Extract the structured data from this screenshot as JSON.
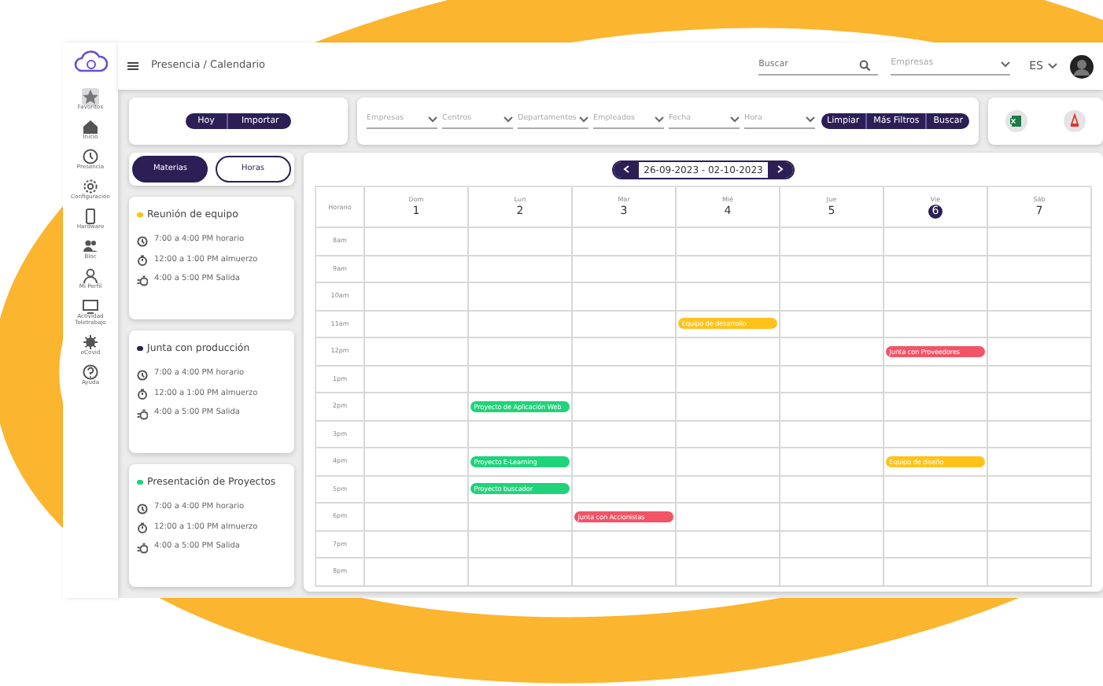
{
  "breadcrumb": "Presencia / Calendario",
  "search": {
    "placeholder": "Buscar"
  },
  "company_select": {
    "placeholder": "Empresas"
  },
  "language": "ES",
  "sidebar": {
    "items": [
      {
        "label": "Favoritos",
        "selected": true
      },
      {
        "label": "Inicio",
        "selected": false
      },
      {
        "label": "Presencia",
        "selected": false
      },
      {
        "label": "Configuración",
        "selected": false
      },
      {
        "label": "Hardware",
        "selected": false
      },
      {
        "label": "Bloc",
        "selected": false
      },
      {
        "label": "Mi Perfil",
        "selected": false
      },
      {
        "label": "Actividad Teletrabajo",
        "selected": false
      },
      {
        "label": "eCovid",
        "selected": false
      },
      {
        "label": "Ayuda",
        "selected": false
      }
    ]
  },
  "actions": [
    "Hoy",
    "Importar"
  ],
  "filters": [
    {
      "placeholder": "Empresas"
    },
    {
      "placeholder": "Centros"
    },
    {
      "placeholder": "Departamentos"
    },
    {
      "placeholder": "Empleados"
    },
    {
      "placeholder": "Fecha"
    },
    {
      "placeholder": "Hora"
    }
  ],
  "filter_buttons": [
    "Limpiar",
    "Más Filtros",
    "Buscar"
  ],
  "view_tabs": [
    {
      "label": "Materias",
      "selected": true
    },
    {
      "label": "Horas",
      "selected": false
    }
  ],
  "schedule_cards": [
    {
      "title": "Reunión de equipo",
      "color": "#ffc107",
      "lines": [
        "7:00 a 4:00 PM horario",
        "12:00 a 1:00 PM almuerzo",
        "4:00 a 5:00 PM Salida"
      ]
    },
    {
      "title": "Junta con producción",
      "color": "#2b1f55",
      "lines": [
        "7:00 a 4:00 PM horario",
        "12:00 a 1:00 PM almuerzo",
        "4:00 a 5:00 PM Salida"
      ]
    },
    {
      "title": "Presentación de Proyectos",
      "color": "#1ed37a",
      "lines": [
        "7:00 a 4:00 PM horario",
        "12:00 a 1:00 PM almuerzo",
        "4:00 a 5:00 PM Salida"
      ]
    }
  ],
  "calendar": {
    "date_range": "26-09-2023 - 02-10-2023",
    "corner_label": "Horario",
    "days": [
      {
        "name": "Dom",
        "number": "1",
        "selected": false
      },
      {
        "name": "Lun",
        "number": "2",
        "selected": false
      },
      {
        "name": "Mar",
        "number": "3",
        "selected": false
      },
      {
        "name": "Mié",
        "number": "4",
        "selected": false
      },
      {
        "name": "Jue",
        "number": "5",
        "selected": false
      },
      {
        "name": "Vie",
        "number": "6",
        "selected": true
      },
      {
        "name": "Sáb",
        "number": "7",
        "selected": false
      }
    ],
    "rows": [
      {
        "hour": "8am",
        "cells": [
          null,
          null,
          null,
          null,
          null,
          null,
          null
        ]
      },
      {
        "hour": "9am",
        "cells": [
          null,
          null,
          null,
          null,
          null,
          null,
          null
        ]
      },
      {
        "hour": "10am",
        "cells": [
          null,
          null,
          null,
          null,
          null,
          null,
          null
        ]
      },
      {
        "hour": "11am",
        "cells": [
          null,
          null,
          null,
          {
            "event": "Equipo de desarrollo",
            "color": "#ffc21a"
          },
          null,
          null,
          null
        ]
      },
      {
        "hour": "12pm",
        "cells": [
          null,
          null,
          null,
          null,
          null,
          {
            "event": "Junta con Proveedores",
            "color": "#f25366"
          },
          null
        ]
      },
      {
        "hour": "1pm",
        "cells": [
          null,
          null,
          null,
          null,
          null,
          null,
          null
        ]
      },
      {
        "hour": "2pm",
        "cells": [
          null,
          {
            "event": "Proyecto de Aplicación Web",
            "color": "#1ed37a"
          },
          null,
          null,
          null,
          null,
          null
        ]
      },
      {
        "hour": "3pm",
        "cells": [
          null,
          null,
          null,
          null,
          null,
          null,
          null
        ]
      },
      {
        "hour": "4pm",
        "cells": [
          null,
          {
            "event": "Proyecto E-Learning",
            "color": "#1ed37a"
          },
          null,
          null,
          null,
          {
            "event": "Equipo de diseño",
            "color": "#ffc21a"
          },
          null
        ]
      },
      {
        "hour": "5pm",
        "cells": [
          null,
          {
            "event": "Proyecto buscador",
            "color": "#1ed37a"
          },
          null,
          null,
          null,
          null,
          null
        ]
      },
      {
        "hour": "6pm",
        "cells": [
          null,
          null,
          {
            "event": "Junta con Accionistas",
            "color": "#f25366"
          },
          null,
          null,
          null,
          null
        ]
      },
      {
        "hour": "7pm",
        "cells": [
          null,
          null,
          null,
          null,
          null,
          null,
          null
        ]
      },
      {
        "hour": "8pm",
        "cells": [
          null,
          null,
          null,
          null,
          null,
          null,
          null
        ]
      }
    ]
  }
}
